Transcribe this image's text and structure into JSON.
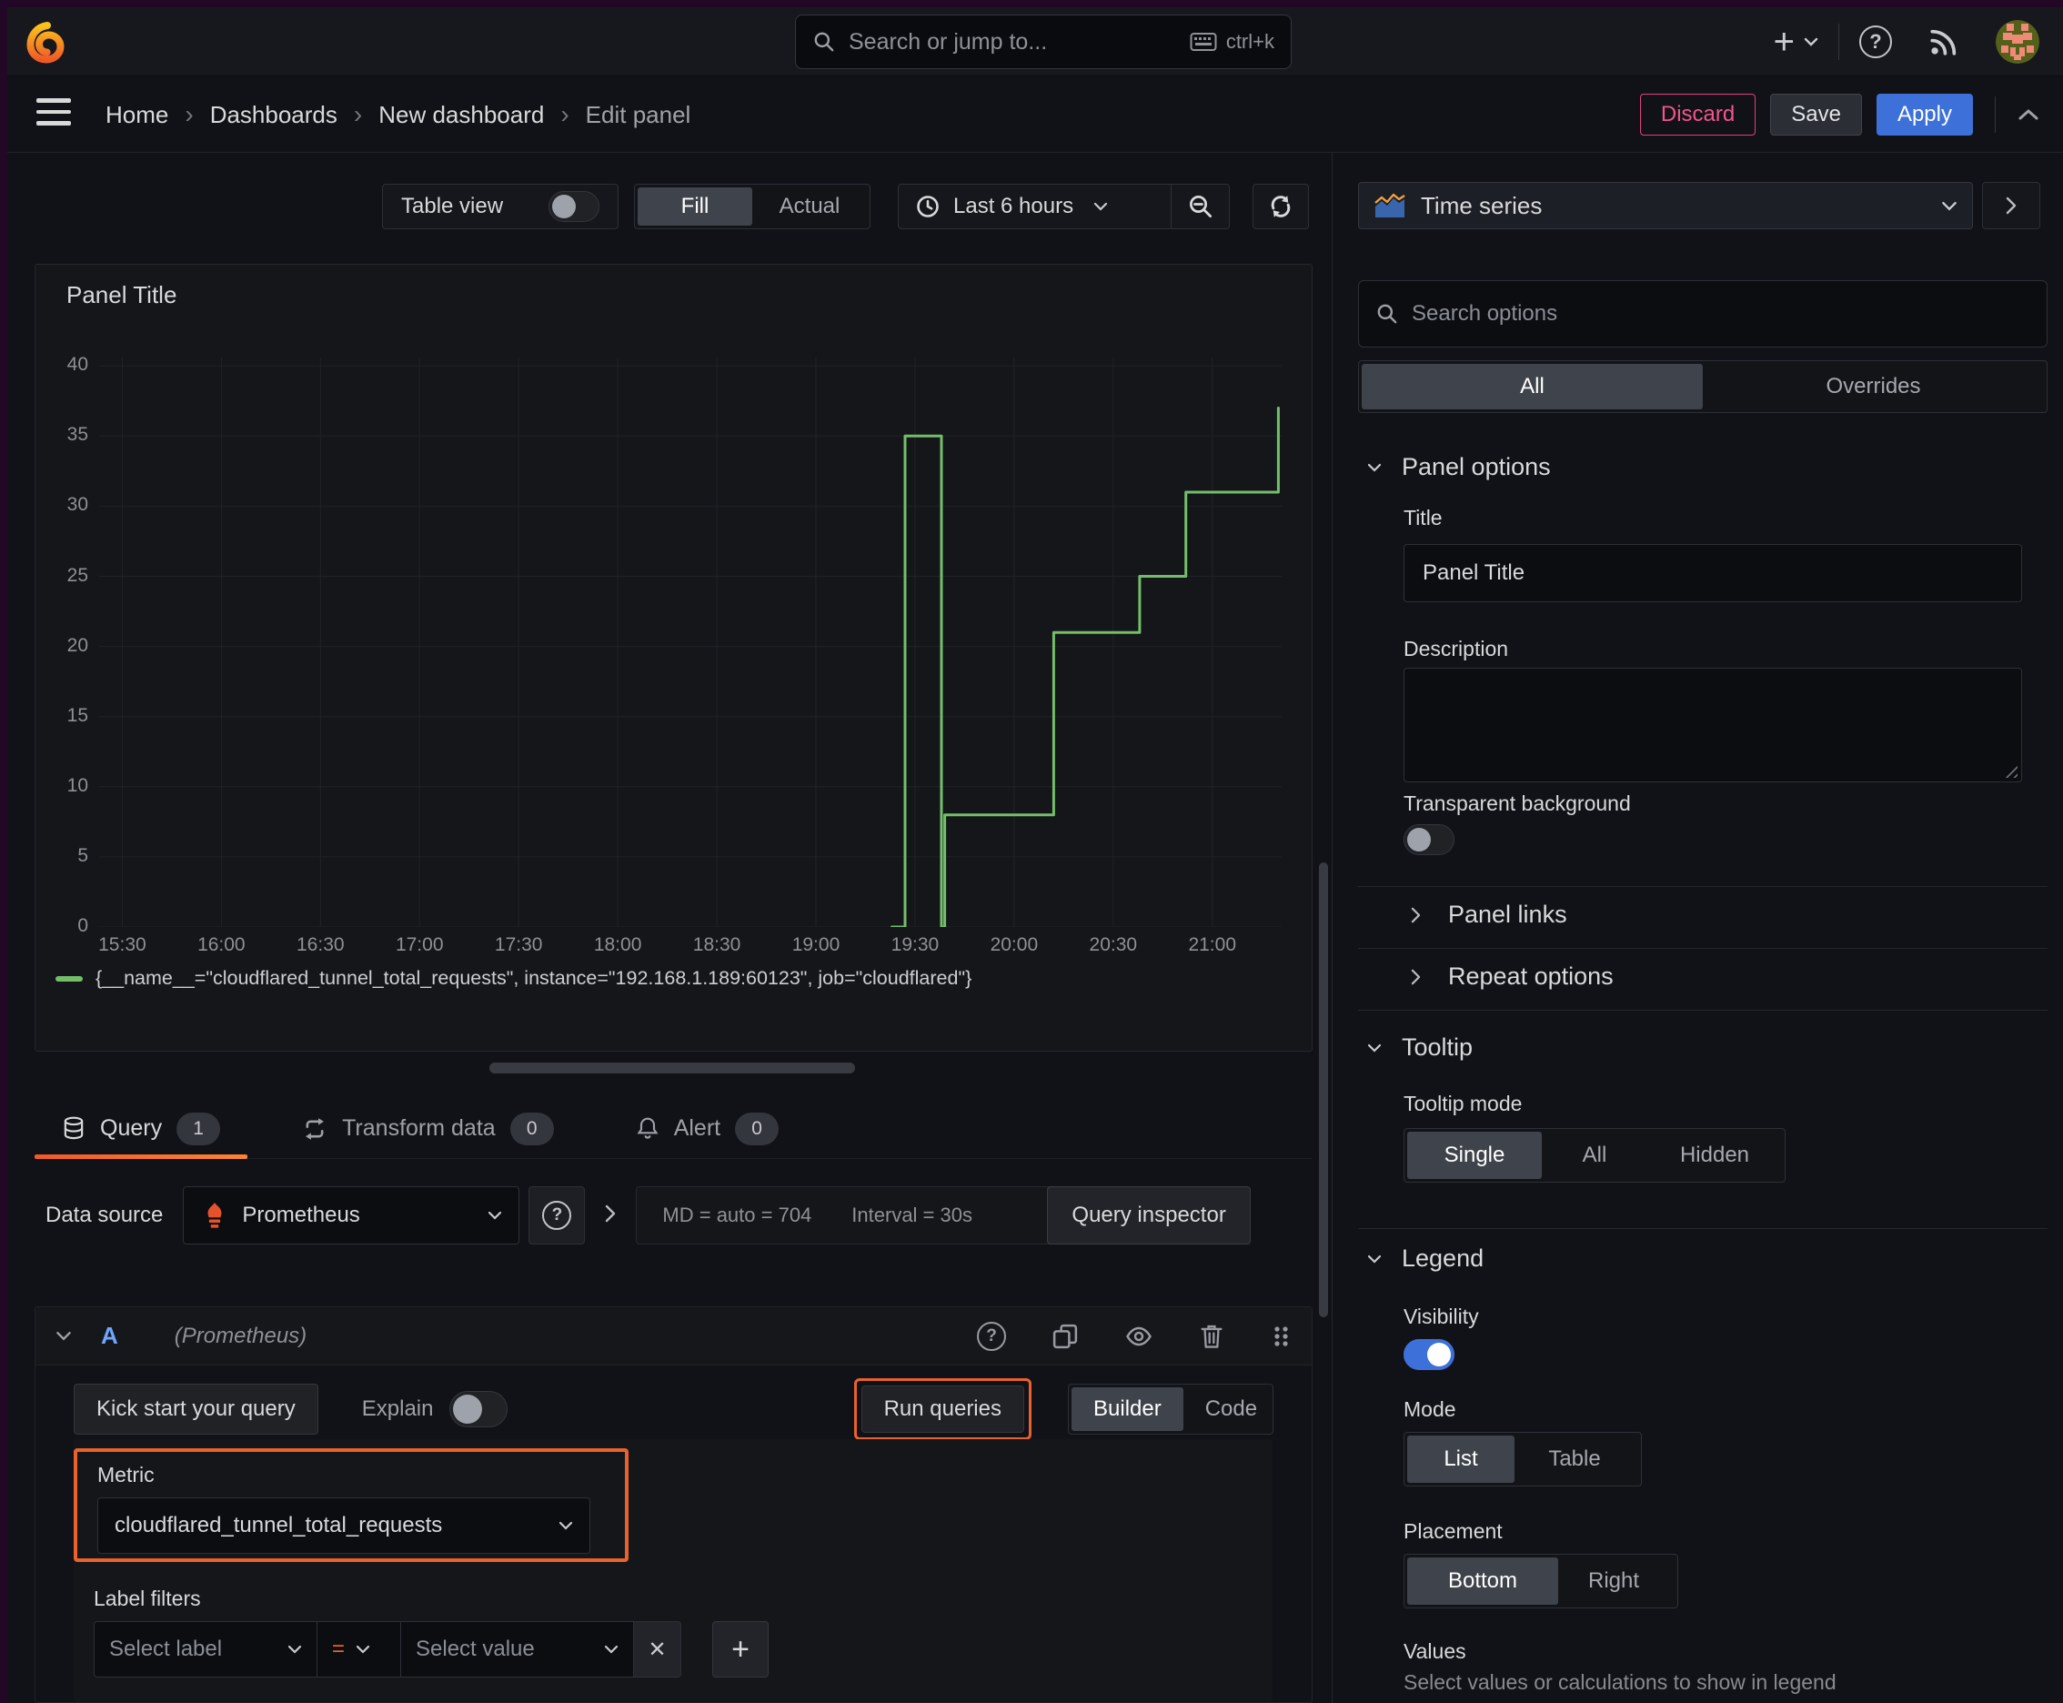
{
  "topnav": {
    "search_placeholder": "Search or jump to...",
    "shortcut": "ctrl+k"
  },
  "breadcrumb": {
    "items": [
      "Home",
      "Dashboards",
      "New dashboard"
    ],
    "current": "Edit panel"
  },
  "header_actions": {
    "discard": "Discard",
    "save": "Save",
    "apply": "Apply"
  },
  "toolbar": {
    "table_view_label": "Table view",
    "fill_label": "Fill",
    "actual_label": "Actual",
    "time_range_label": "Last 6 hours"
  },
  "panel": {
    "title": "Panel Title"
  },
  "chart_data": {
    "type": "line",
    "line_style": "stepped",
    "title": "Panel Title",
    "xlabel": "",
    "ylabel": "",
    "grid": true,
    "legend_position": "bottom",
    "series": [
      {
        "name": "{__name__=\"cloudflared_tunnel_total_requests\", instance=\"192.168.1.189:60123\", job=\"cloudflared\"}",
        "color": "#73bf69",
        "points_min_value": [
          [
            233,
            0
          ],
          [
            237,
            0
          ],
          [
            237,
            35
          ],
          [
            248,
            35
          ],
          [
            248,
            0
          ],
          [
            249,
            0
          ],
          [
            249,
            8
          ],
          [
            282,
            8
          ],
          [
            282,
            21
          ],
          [
            308,
            21
          ],
          [
            308,
            25
          ],
          [
            322,
            25
          ],
          [
            322,
            31
          ],
          [
            350,
            31
          ],
          [
            350,
            37
          ]
        ]
      }
    ],
    "x_axis": {
      "start_label_time": "15:30",
      "tick_labels": [
        "15:30",
        "16:00",
        "16:30",
        "17:00",
        "17:30",
        "18:00",
        "18:30",
        "19:00",
        "19:30",
        "20:00",
        "20:30",
        "21:00"
      ],
      "tick_minutes": [
        0,
        30,
        60,
        90,
        120,
        150,
        180,
        210,
        240,
        270,
        300,
        330
      ],
      "domain_minutes": [
        -7,
        351
      ]
    },
    "y_axis": {
      "ticks": [
        0,
        5,
        10,
        15,
        20,
        25,
        30,
        35,
        40
      ],
      "domain": [
        0,
        40.6
      ]
    }
  },
  "tabs": [
    {
      "label": "Query",
      "count": "1"
    },
    {
      "label": "Transform data",
      "count": "0"
    },
    {
      "label": "Alert",
      "count": "0"
    }
  ],
  "datasource_row": {
    "label": "Data source",
    "value": "Prometheus",
    "stat_md": "MD = auto = 704",
    "stat_interval": "Interval = 30s",
    "inspector_label": "Query inspector"
  },
  "query_editor": {
    "ref_id": "A",
    "datasource_hint": "(Prometheus)",
    "kick_start_label": "Kick start your query",
    "explain_label": "Explain",
    "run_queries_label": "Run queries",
    "builder_label": "Builder",
    "code_label": "Code",
    "metric": {
      "label": "Metric",
      "value": "cloudflared_tunnel_total_requests"
    },
    "label_filters": {
      "label": "Label filters",
      "select_label_placeholder": "Select label",
      "operator": "=",
      "select_value_placeholder": "Select value"
    }
  },
  "sidebar": {
    "visualization": "Time series",
    "search_placeholder": "Search options",
    "tabs": {
      "all": "All",
      "overrides": "Overrides"
    },
    "panel_options": {
      "heading": "Panel options",
      "title_label": "Title",
      "title_value": "Panel Title",
      "description_label": "Description",
      "transparent_label": "Transparent background",
      "panel_links": "Panel links",
      "repeat_options": "Repeat options"
    },
    "tooltip": {
      "heading": "Tooltip",
      "mode_label": "Tooltip mode",
      "options": [
        "Single",
        "All",
        "Hidden"
      ],
      "selected": "Single"
    },
    "legend": {
      "heading": "Legend",
      "visibility_label": "Visibility",
      "mode_label": "Mode",
      "mode_options": [
        "List",
        "Table"
      ],
      "mode_selected": "List",
      "placement_label": "Placement",
      "placement_options": [
        "Bottom",
        "Right"
      ],
      "placement_selected": "Bottom",
      "values_label": "Values",
      "values_description": "Select values or calculations to show in legend"
    }
  },
  "colors": {
    "accent_orange": "#e8622d",
    "series_green": "#73bf69",
    "primary_blue": "#3d71d9",
    "danger_pink": "#e5407a"
  }
}
